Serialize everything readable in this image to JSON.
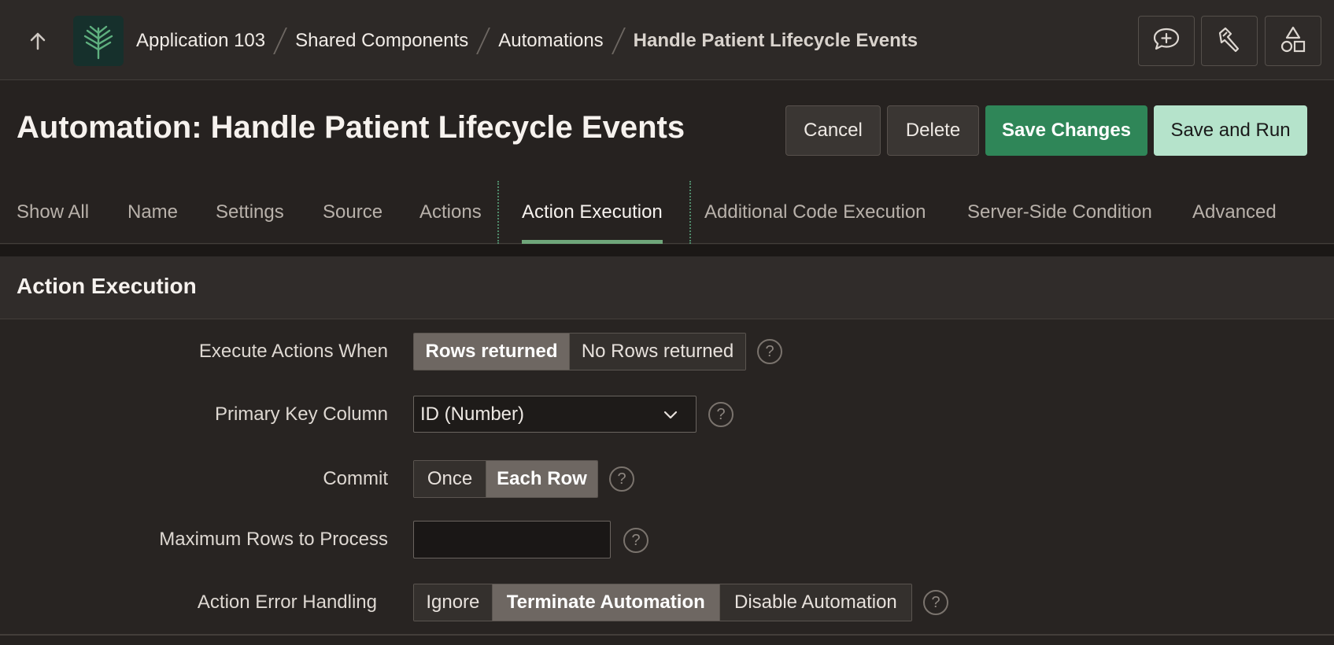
{
  "breadcrumb": {
    "items": [
      "Application 103",
      "Shared Components",
      "Automations",
      "Handle Patient Lifecycle Events"
    ]
  },
  "top_icons": [
    "add-comment-icon",
    "flashlight-icon",
    "shapes-icon"
  ],
  "page": {
    "title": "Automation: Handle Patient Lifecycle Events"
  },
  "buttons": {
    "cancel": "Cancel",
    "delete": "Delete",
    "save_changes": "Save Changes",
    "save_and_run": "Save and Run"
  },
  "tabs": [
    "Show All",
    "Name",
    "Settings",
    "Source",
    "Actions",
    "Action Execution",
    "Additional Code Execution",
    "Server-Side Condition",
    "Advanced"
  ],
  "active_tab": "Action Execution",
  "section": {
    "title": "Action Execution"
  },
  "form": {
    "execute_when": {
      "label": "Execute Actions When",
      "options": [
        "Rows returned",
        "No Rows returned"
      ],
      "selected": "Rows returned"
    },
    "primary_key": {
      "label": "Primary Key Column",
      "value": "ID (Number)"
    },
    "commit": {
      "label": "Commit",
      "options": [
        "Once",
        "Each Row"
      ],
      "selected": "Each Row"
    },
    "max_rows": {
      "label": "Maximum Rows to Process",
      "value": ""
    },
    "error_handling": {
      "label": "Action Error Handling",
      "options": [
        "Ignore",
        "Terminate Automation",
        "Disable Automation"
      ],
      "selected": "Terminate Automation"
    },
    "help_glyph": "?"
  },
  "colors": {
    "accent_green": "#2f8658",
    "light_green": "#b5e3cb",
    "tab_underline": "#6fa67a",
    "background": "#262220"
  }
}
